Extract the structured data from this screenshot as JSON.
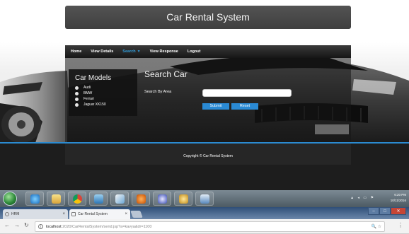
{
  "header": {
    "title": "Car Rental System"
  },
  "nav": {
    "items": [
      {
        "label": "Home"
      },
      {
        "label": "View Details"
      },
      {
        "label": "Search"
      },
      {
        "label": "View Response"
      },
      {
        "label": "Logout"
      }
    ]
  },
  "car_models": {
    "title": "Car Models",
    "options": [
      "Audi",
      "BMW",
      "Ferrari",
      "Jaguar XK150"
    ]
  },
  "search": {
    "title": "Search Car",
    "field_label": "Search By Area",
    "input_value": "",
    "submit_label": "Submit",
    "reset_label": "Reset"
  },
  "footer": {
    "copyright": "Copyright © Car Rental System"
  },
  "taskbar": {
    "time": "6:20 PM",
    "date": "10/11/2016"
  },
  "browser": {
    "tabs": [
      {
        "title": "HRM",
        "active": false
      },
      {
        "title": "Car Rental System",
        "active": true
      }
    ],
    "url_host": "localhost",
    "url_rest": ":2020/CarRentalSystem/send.jsp?a=kavya&dr=1100"
  },
  "colors": {
    "accent": "#2a8ad4",
    "footer_line": "#2b8bd1",
    "active_nav": "#2f9bd8"
  }
}
